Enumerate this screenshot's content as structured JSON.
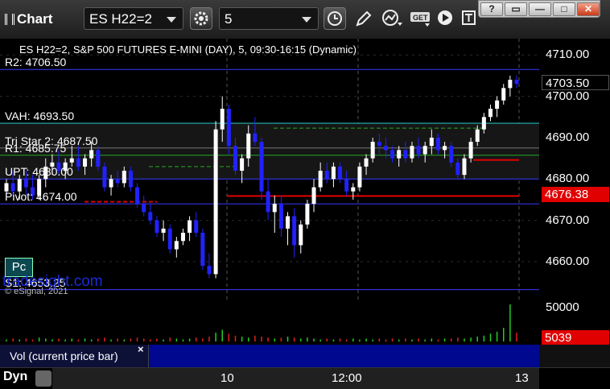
{
  "window": {
    "title": "Chart",
    "symbol_value": "ES H22=2",
    "interval_value": "5"
  },
  "toolbar": {
    "icons": [
      "gear-icon",
      "clock-icon",
      "pencil-icon",
      "cursor-icon",
      "get-icon",
      "play-icon",
      "text-icon"
    ]
  },
  "window_controls": [
    "?",
    "▭",
    "—",
    "□",
    "✕"
  ],
  "chart": {
    "title": "ES H22=2, S&P 500 FUTURES E-MINI (DAY), 5, 09:30-16:15 (Dynamic)",
    "y_ticks": [
      "4710.00",
      "4700.00",
      "4690.00",
      "4680.00",
      "4670.00",
      "4660.00"
    ],
    "current_price": "4703.50",
    "red_price": "4676.38",
    "levels": [
      {
        "label": "R2: 4706.50",
        "value": 4706.5,
        "color": "#3a3aff"
      },
      {
        "label": "VAH: 4693.50",
        "value": 4693.5,
        "color": "#22cccc"
      },
      {
        "label": "Tri Star 2: 4687.50",
        "value": 4687.5,
        "color": "#777777"
      },
      {
        "label": "R1: 4685.75",
        "value": 4685.75,
        "color": "#22aa22"
      },
      {
        "label": "UPT: 4680.00",
        "value": 4680,
        "color": "#3a3aff"
      },
      {
        "label": "Pivot: 4674.00",
        "value": 4674,
        "color": "#3a3aff"
      },
      {
        "label": "S1: 4653.25",
        "value": 4653.25,
        "color": "#3a3aff"
      }
    ],
    "pc_button": "Pc",
    "watermark": "tradesight.com",
    "copyright": "© eSignal, 2021",
    "colors": {
      "up": "#ffffff",
      "down": "#2222ff",
      "seq_magenta": "#e020e0",
      "seq_green": "#22aa22"
    }
  },
  "chart_data": {
    "type": "candlestick",
    "ylim": [
      4652,
      4712
    ],
    "x_ticks": [
      "10",
      "12:00",
      "13"
    ],
    "candles": [
      [
        4677,
        4680,
        4676,
        4679
      ],
      [
        4679,
        4682,
        4676,
        4677
      ],
      [
        4677,
        4681,
        4675,
        4680
      ],
      [
        4680,
        4682,
        4676,
        4678
      ],
      [
        4678,
        4681,
        4675,
        4676
      ],
      [
        4676,
        4681,
        4675,
        4680
      ],
      [
        4680,
        4685,
        4678,
        4683
      ],
      [
        4683,
        4686,
        4681,
        4684
      ],
      [
        4684,
        4687,
        4681,
        4682
      ],
      [
        4682,
        4685,
        4680,
        4684
      ],
      [
        4684,
        4688,
        4683,
        4685
      ],
      [
        4685,
        4688,
        4682,
        4683
      ],
      [
        4683,
        4686,
        4681,
        4685
      ],
      [
        4685,
        4689,
        4683,
        4687
      ],
      [
        4687,
        4688,
        4682,
        4683
      ],
      [
        4683,
        4684,
        4677,
        4678
      ],
      [
        4678,
        4681,
        4676,
        4680
      ],
      [
        4680,
        4682,
        4678,
        4679
      ],
      [
        4679,
        4683,
        4678,
        4682
      ],
      [
        4682,
        4683,
        4677,
        4678
      ],
      [
        4678,
        4679,
        4673,
        4674
      ],
      [
        4674,
        4676,
        4671,
        4672
      ],
      [
        4672,
        4674,
        4669,
        4670
      ],
      [
        4670,
        4671,
        4666,
        4667
      ],
      [
        4667,
        4670,
        4665,
        4668
      ],
      [
        4668,
        4669,
        4662,
        4663
      ],
      [
        4663,
        4666,
        4661,
        4665
      ],
      [
        4665,
        4668,
        4664,
        4667
      ],
      [
        4667,
        4671,
        4665,
        4670
      ],
      [
        4670,
        4672,
        4666,
        4667
      ],
      [
        4667,
        4668,
        4658,
        4659
      ],
      [
        4659,
        4662,
        4656,
        4657
      ],
      [
        4657,
        4694,
        4656,
        4692
      ],
      [
        4692,
        4700,
        4689,
        4697
      ],
      [
        4697,
        4698,
        4686,
        4688
      ],
      [
        4688,
        4690,
        4681,
        4682
      ],
      [
        4682,
        4686,
        4679,
        4685
      ],
      [
        4685,
        4693,
        4683,
        4691
      ],
      [
        4691,
        4695,
        4688,
        4689
      ],
      [
        4689,
        4690,
        4675,
        4677
      ],
      [
        4677,
        4680,
        4670,
        4672
      ],
      [
        4672,
        4676,
        4667,
        4674
      ],
      [
        4674,
        4676,
        4666,
        4668
      ],
      [
        4668,
        4672,
        4664,
        4671
      ],
      [
        4671,
        4673,
        4661,
        4664
      ],
      [
        4664,
        4670,
        4662,
        4669
      ],
      [
        4669,
        4675,
        4668,
        4674
      ],
      [
        4674,
        4680,
        4672,
        4678
      ],
      [
        4678,
        4684,
        4677,
        4682
      ],
      [
        4682,
        4684,
        4679,
        4680
      ],
      [
        4680,
        4684,
        4678,
        4683
      ],
      [
        4683,
        4684,
        4679,
        4680
      ],
      [
        4680,
        4682,
        4676,
        4677
      ],
      [
        4677,
        4679,
        4675,
        4678
      ],
      [
        4678,
        4684,
        4677,
        4683
      ],
      [
        4683,
        4686,
        4681,
        4685
      ],
      [
        4685,
        4690,
        4684,
        4689
      ],
      [
        4689,
        4691,
        4686,
        4688
      ],
      [
        4688,
        4690,
        4685,
        4687
      ],
      [
        4687,
        4688,
        4684,
        4685
      ],
      [
        4685,
        4688,
        4683,
        4687
      ],
      [
        4687,
        4689,
        4684,
        4685
      ],
      [
        4685,
        4689,
        4684,
        4688
      ],
      [
        4688,
        4690,
        4685,
        4686
      ],
      [
        4686,
        4689,
        4684,
        4688
      ],
      [
        4688,
        4692,
        4686,
        4690
      ],
      [
        4690,
        4691,
        4686,
        4687
      ],
      [
        4687,
        4689,
        4685,
        4688
      ],
      [
        4688,
        4689,
        4683,
        4684
      ],
      [
        4684,
        4685,
        4680,
        4681
      ],
      [
        4681,
        4686,
        4680,
        4685
      ],
      [
        4685,
        4690,
        4684,
        4689
      ],
      [
        4689,
        4693,
        4688,
        4692
      ],
      [
        4692,
        4696,
        4691,
        4695
      ],
      [
        4695,
        4698,
        4694,
        4697
      ],
      [
        4697,
        4700,
        4695,
        4699
      ],
      [
        4699,
        4703,
        4698,
        4702
      ],
      [
        4702,
        4705,
        4700,
        4704
      ],
      [
        4704,
        4705,
        4702,
        4703
      ]
    ],
    "volume_ticks": [
      "50000",
      "5039"
    ]
  },
  "volume": {
    "label": "Vol (current price bar)",
    "close": "×",
    "bars": [
      2,
      3,
      2,
      3,
      2,
      4,
      3,
      2,
      3,
      2,
      3,
      2,
      3,
      2,
      3,
      4,
      2,
      3,
      2,
      3,
      4,
      3,
      2,
      3,
      2,
      4,
      3,
      2,
      3,
      4,
      3,
      5,
      9,
      12,
      8,
      6,
      5,
      4,
      6,
      5,
      4,
      3,
      4,
      5,
      4,
      3,
      4,
      3,
      2,
      3,
      2,
      3,
      2,
      3,
      2,
      3,
      2,
      3,
      2,
      3,
      2,
      3,
      2,
      3,
      2,
      3,
      2,
      3,
      3,
      4,
      3,
      4,
      5,
      6,
      8,
      10,
      14,
      38,
      9
    ]
  },
  "bottom": {
    "dyn_label": "Dyn"
  }
}
